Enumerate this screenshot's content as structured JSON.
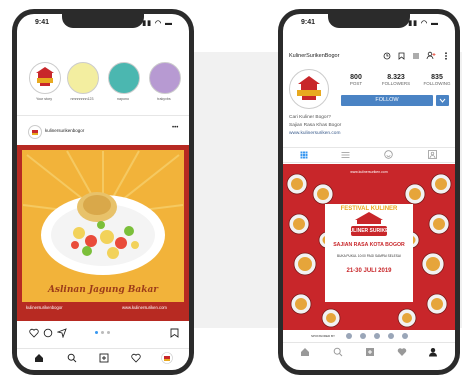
{
  "left_phone": {
    "status_time": "9:41",
    "stories": [
      {
        "label": "Your story",
        "color": "#ffffff"
      },
      {
        "label": "nmnnnnnn123",
        "color": "#f3eea0"
      },
      {
        "label": "napono",
        "color": "#4bb7b0"
      },
      {
        "label": "trakyvbs",
        "color": "#b79ad2"
      }
    ],
    "post": {
      "username": "kulinersurikenbogor",
      "more": "•••",
      "title": "Aslinan Jagung Bakar",
      "footer_left": "kulinersurikenbogor",
      "footer_right": "www.kulinersuriken.com",
      "colors": {
        "bg": "#f2b33a",
        "frame": "#b72a22"
      }
    },
    "nav_icons": [
      "home-icon",
      "search-icon",
      "add-icon",
      "heart-icon",
      "profile-icon"
    ]
  },
  "right_phone": {
    "status_time": "9:41",
    "username": "KulinerSurikenBogor",
    "stats": [
      {
        "value": "800",
        "label": "POST"
      },
      {
        "value": "8.323",
        "label": "FOLLOWERS"
      },
      {
        "value": "835",
        "label": "FOLLOWING"
      }
    ],
    "follow_label": "FOLLOW",
    "bio": [
      "Cari Kuliner Bogor?",
      "Sajian Rasa Khas Bogor",
      "www.kulinersuriken.com"
    ],
    "poster": {
      "top_text": "www.kulinersuriken.com",
      "line1": "FESTIVAL KULINER",
      "brand": "KULINER SURIKEN",
      "line2": "SAJIAN RASA KOTA BOGOR",
      "line3": "BUKA PUKUL 10:00 PAGI SAMPAI SELESAI",
      "dates": "21-30 JULI 2019",
      "sponsors": "SPONSORED BY",
      "colors": {
        "bg": "#c8262a",
        "panel": "#ffffff",
        "title": "#e8a91f"
      }
    },
    "nav_icons": [
      "home-icon",
      "search-icon",
      "add-icon",
      "heart-icon",
      "profile-icon"
    ]
  }
}
